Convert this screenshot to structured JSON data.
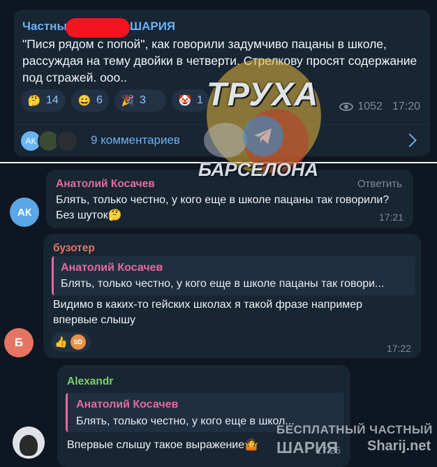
{
  "post": {
    "author_left": "Частны",
    "author_right": "ШАРИЯ",
    "text": "\"Пися рядом с попой\", как говорили задумчиво пацаны в школе, рассуждая на тему двойки в четверти. Стрелкову просят содержание под стражей. ооо..",
    "reactions": [
      {
        "emoji": "🤔",
        "count": "14"
      },
      {
        "emoji": "😀",
        "count": "6"
      },
      {
        "emoji": "🎉",
        "count": "3"
      },
      {
        "emoji": "🤡",
        "count": "1"
      }
    ],
    "views": "1052",
    "time": "17:20",
    "comments_avatar_initials": "АК",
    "comments_label": "9 комментариев"
  },
  "comments": [
    {
      "author": "Анатолий Косачев",
      "reply_label": "Ответить",
      "avatar_initials": "АК",
      "text": "Блять, только честно, у кого еще в школе пацаны так говорили? Без шуток🤔",
      "time": "17:21"
    },
    {
      "author": "бузотер",
      "avatar_initials": "Б",
      "quote_author": "Анатолий Косачев",
      "quote_text": "Блять, только честно, у кого еще в школе пацаны так говори...",
      "text": "Видимо в каких-то гейских школах я такой фразе например впервые слышу",
      "reactions": [
        "👍",
        "SD"
      ],
      "time": "17:22"
    },
    {
      "author": "Alexandr",
      "quote_author": "Анатолий Косачев",
      "quote_text": "Блять, только честно, у кого еще в школ...",
      "text": "Впервые слышу такое выражение🤷",
      "time": "17:25"
    }
  ],
  "watermarks": {
    "center_top": "ТРУХА",
    "center_bottom": "БАРСЕЛОНА",
    "bottom_right_line1": "БЕСПЛАТНЫЙ ЧАСТНЫЙ",
    "bottom_right_line2": "ШАРИЯ",
    "bottom_right_site": "Sharij.net"
  },
  "colors": {
    "background": "#0e1621",
    "bubble": "#182533",
    "link": "#6ab3f3",
    "quote_accent": "#e46a9d",
    "author_buzoter": "#e57562",
    "author_alexandr": "#7dcf71",
    "redaction": "#f2141e"
  }
}
